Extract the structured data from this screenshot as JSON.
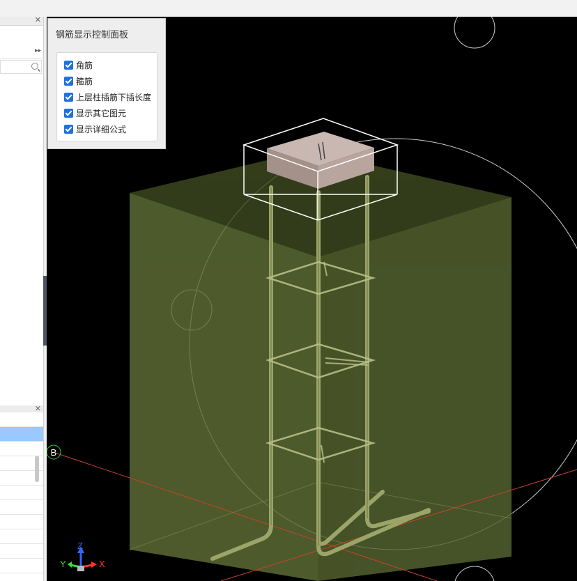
{
  "control_panel": {
    "title": "钢筋显示控制面板",
    "options": [
      {
        "label": "角筋",
        "checked": true
      },
      {
        "label": "箍筋",
        "checked": true
      },
      {
        "label": "上层柱插筋下插长度",
        "checked": true
      },
      {
        "label": "显示其它图元",
        "checked": true
      },
      {
        "label": "显示详细公式",
        "checked": true
      }
    ]
  },
  "viewport": {
    "axis_marker_label": "B",
    "axes": {
      "x": "X",
      "y": "Y",
      "z": "Z"
    },
    "colors": {
      "background": "#000000",
      "concrete": "#5f6e35",
      "rebar": "#9ba56a",
      "column_cap": "#b7a6a0",
      "axis_line": "#c8442a",
      "x_axis": "#ff3333",
      "y_axis": "#33dd33",
      "z_axis": "#3366ff"
    }
  },
  "left_pane": {
    "close_icon": "close-icon",
    "expand_icon": "chevron-double-right-icon",
    "search_icon": "search-icon"
  }
}
